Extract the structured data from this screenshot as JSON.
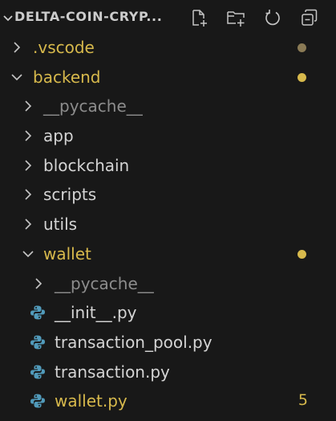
{
  "colors": {
    "modified": "#d7b94c",
    "default_text": "#d4d4d4",
    "ignored_text": "#8c8c8c",
    "ignored_dot": "#8a7a55",
    "python_icon": "#519aba"
  },
  "explorer": {
    "title": "DELTA-COIN-CRYP...",
    "actions": [
      {
        "name": "new-file",
        "icon": "new-file-icon"
      },
      {
        "name": "new-folder",
        "icon": "new-folder-icon"
      },
      {
        "name": "refresh",
        "icon": "refresh-icon"
      },
      {
        "name": "collapse-all",
        "icon": "collapse-all-icon"
      }
    ],
    "tree": [
      {
        "label": ".vscode",
        "type": "folder",
        "expanded": false,
        "depth": 0,
        "status": "modified-dim",
        "decoration": "dot"
      },
      {
        "label": "backend",
        "type": "folder",
        "expanded": true,
        "depth": 0,
        "status": "modified",
        "decoration": "dot"
      },
      {
        "label": "__pycache__",
        "type": "folder",
        "expanded": false,
        "depth": 1,
        "status": "ignored"
      },
      {
        "label": "app",
        "type": "folder",
        "expanded": false,
        "depth": 1,
        "status": "default"
      },
      {
        "label": "blockchain",
        "type": "folder",
        "expanded": false,
        "depth": 1,
        "status": "default"
      },
      {
        "label": "scripts",
        "type": "folder",
        "expanded": false,
        "depth": 1,
        "status": "default"
      },
      {
        "label": "utils",
        "type": "folder",
        "expanded": false,
        "depth": 1,
        "status": "default"
      },
      {
        "label": "wallet",
        "type": "folder",
        "expanded": true,
        "depth": 1,
        "status": "modified",
        "decoration": "dot"
      },
      {
        "label": "__pycache__",
        "type": "folder",
        "expanded": false,
        "depth": 2,
        "status": "ignored"
      },
      {
        "label": "__init__.py",
        "type": "file",
        "icon": "python-icon",
        "depth": 2,
        "status": "default"
      },
      {
        "label": "transaction_pool.py",
        "type": "file",
        "icon": "python-icon",
        "depth": 2,
        "status": "default"
      },
      {
        "label": "transaction.py",
        "type": "file",
        "icon": "python-icon",
        "depth": 2,
        "status": "default"
      },
      {
        "label": "wallet.py",
        "type": "file",
        "icon": "python-icon",
        "depth": 2,
        "status": "modified",
        "badge": "5"
      }
    ]
  }
}
